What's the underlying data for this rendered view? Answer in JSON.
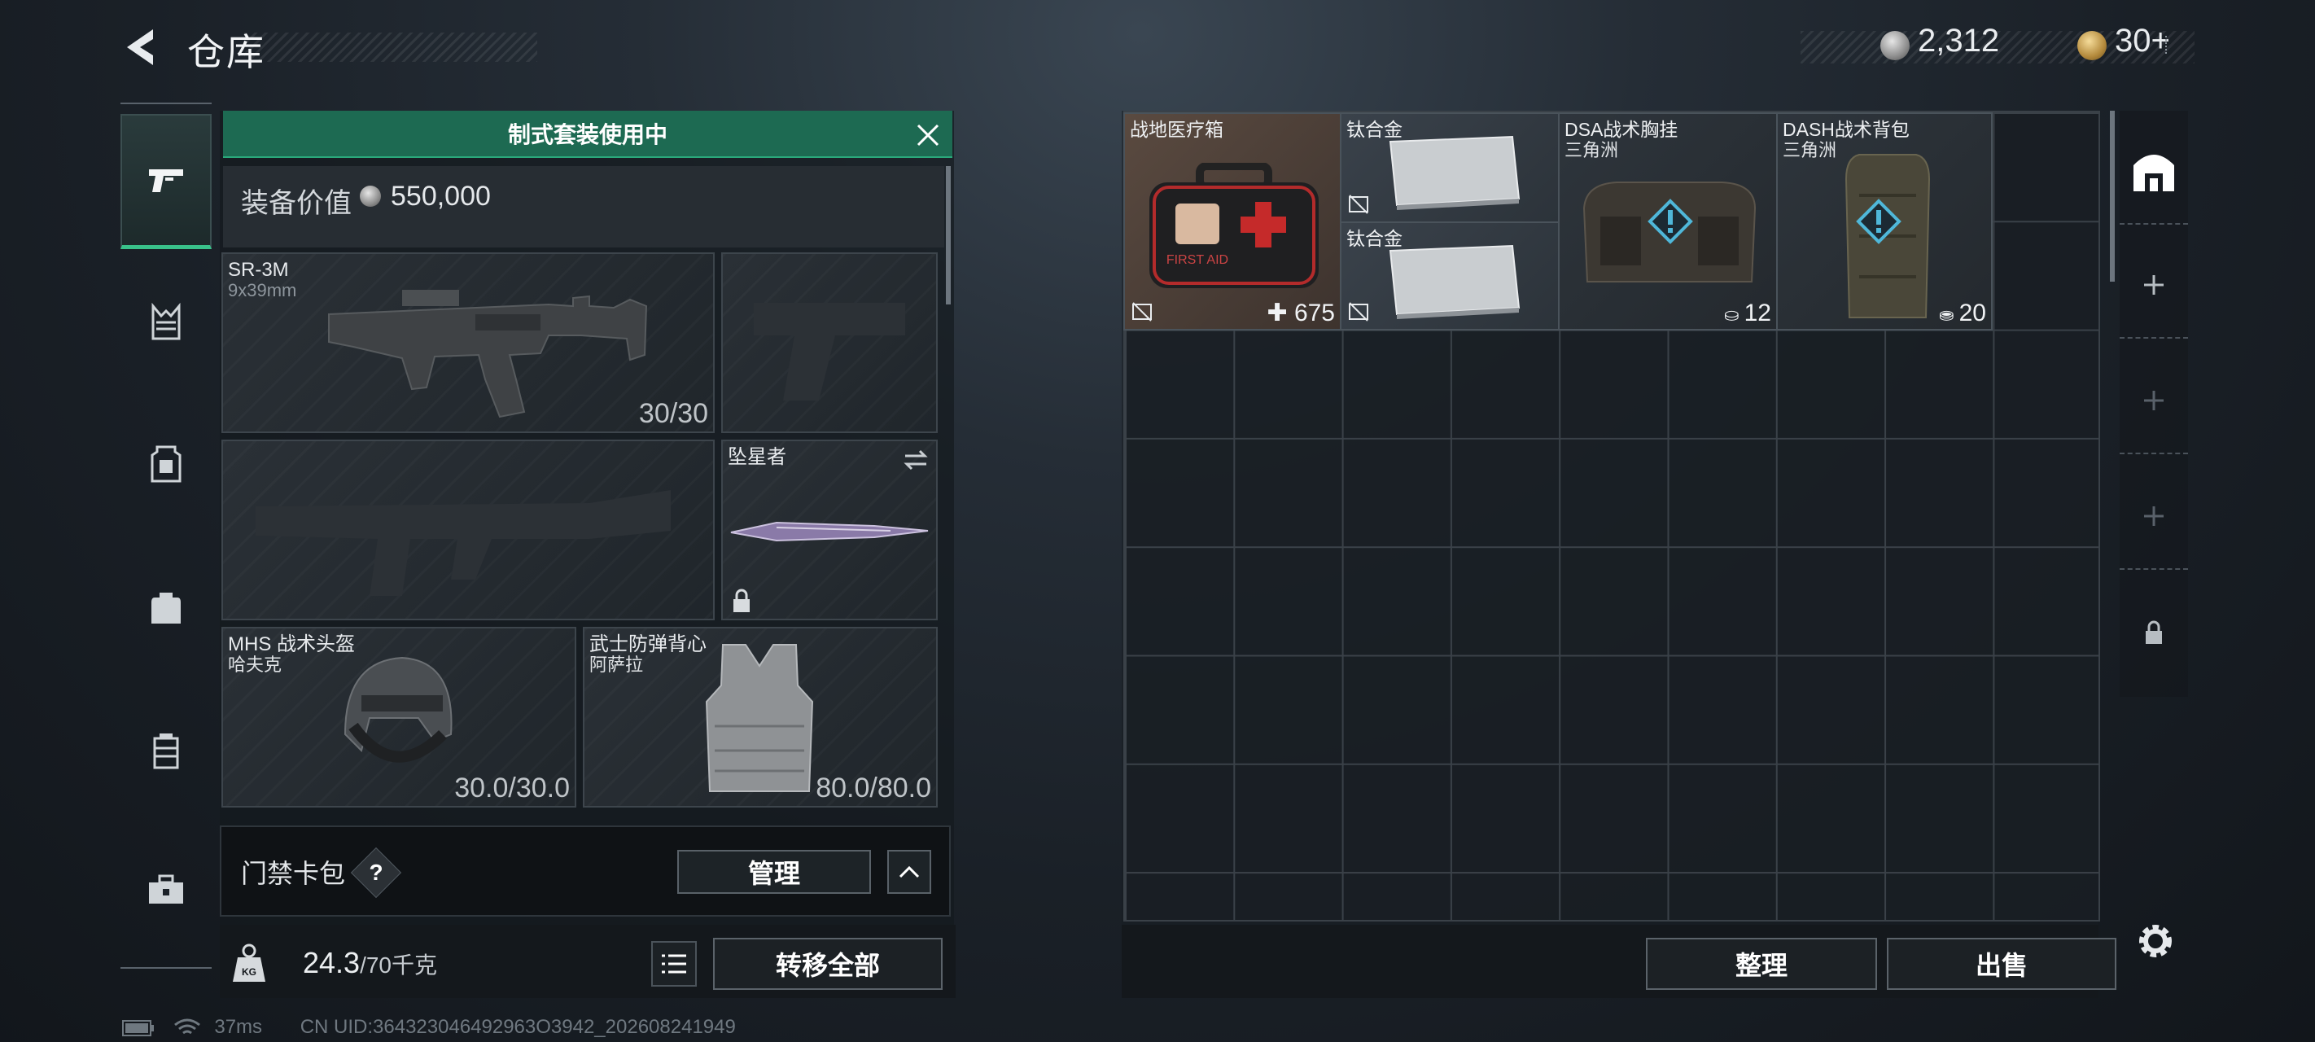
{
  "header": {
    "title": "仓库"
  },
  "currency": {
    "silver": "2,312",
    "gold": "30",
    "gold_plus": "+"
  },
  "loadout": {
    "banner": "制式套装使用中",
    "value_label": "装备价值",
    "value": "550,000",
    "slots": {
      "primary": {
        "name": "SR-3M",
        "sub": "9x39mm",
        "value": "30/30"
      },
      "melee": {
        "name": "坠星者"
      },
      "helmet": {
        "name": "MHS 战术头盔",
        "sub": "哈夫克",
        "value": "30.0/30.0"
      },
      "armor": {
        "name": "武士防弹背心",
        "sub": "阿萨拉",
        "value": "80.0/80.0"
      }
    },
    "card_pack": {
      "label": "门禁卡包",
      "help": "?",
      "manage_label": "管理"
    },
    "weight": {
      "current": "24.3",
      "max": "/70千克"
    },
    "transfer_label": "转移全部"
  },
  "storage": {
    "items": [
      {
        "name": "战地医疗箱",
        "sub": "",
        "count": "675",
        "count_icon": "plus-icon"
      },
      {
        "name": "钛合金",
        "sub": "",
        "count": ""
      },
      {
        "name": "钛合金",
        "sub": "",
        "count": ""
      },
      {
        "name": "DSA战术胸挂",
        "sub": "三角洲",
        "count": "12",
        "count_icon": "vest-icon"
      },
      {
        "name": "DASH战术背包",
        "sub": "三角洲",
        "count": "20",
        "count_icon": "bag-icon"
      }
    ],
    "medkit_text": "FIRST AID",
    "sort_label": "整理",
    "sell_label": "出售"
  },
  "status": {
    "ping": "37ms",
    "uid": "CN UID:364323046492963O3942_202608241949"
  },
  "colors": {
    "accent": "#1d6a52",
    "accent_line": "#39c18a",
    "warning": "#4fb7d9"
  },
  "icons": [
    "back-arrow-icon",
    "pistol-icon",
    "armor-icon",
    "rig-icon",
    "backpack-icon",
    "case-icon",
    "toolbox-icon",
    "close-icon",
    "lock-icon",
    "swap-icon",
    "help-icon",
    "chevron-up-icon",
    "list-icon",
    "weight-icon",
    "no-drop-icon",
    "warning-icon",
    "home-icon",
    "plus-icon",
    "gear-icon",
    "battery-icon",
    "wifi-icon"
  ]
}
